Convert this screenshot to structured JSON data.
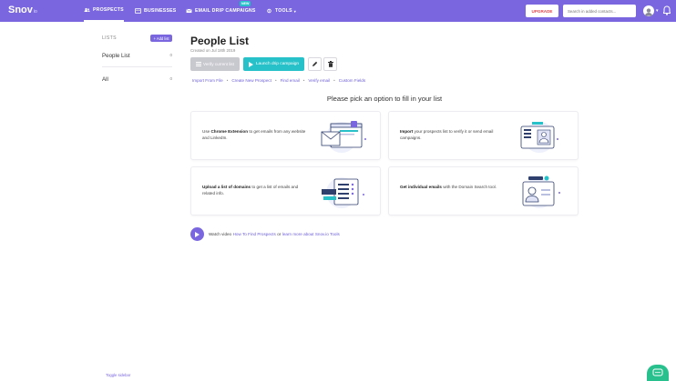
{
  "header": {
    "logo": "Snov",
    "logo_suffix": "io",
    "nav": [
      {
        "label": "PROSPECTS",
        "icon": "people-icon",
        "active": true
      },
      {
        "label": "BUSINESSES",
        "icon": "building-icon",
        "active": false
      },
      {
        "label": "EMAIL DRIP CAMPAIGNS",
        "icon": "mail-icon",
        "active": false,
        "badge": "NEW"
      },
      {
        "label": "TOOLS",
        "icon": "tools-icon",
        "active": false
      }
    ],
    "upgrade_label": "UPGRADE",
    "search_placeholder": "Search in added contacts...",
    "accent": "#7a67e0"
  },
  "sidebar": {
    "title": "LISTS",
    "add_list_label": "+ Add list",
    "items": [
      {
        "label": "People List",
        "count": "0"
      },
      {
        "label": "All",
        "count": "0"
      }
    ],
    "toggle_label": "Toggle sidebar"
  },
  "main": {
    "title": "People List",
    "created": "Created on Jul 18th 2019",
    "verify_label": "Verify current list",
    "launch_label": "Launch drip campaign",
    "links": [
      "Import From File",
      "Create New Prospect",
      "Find email",
      "Verify email",
      "Custom Fields"
    ],
    "pick_title": "Please pick an option to fill in your list",
    "cards": [
      {
        "bold": "Chrome Extension",
        "pre": "Use ",
        "post": " to get emails from any website and LinkedIn.",
        "icon": "browser-mail-illustration"
      },
      {
        "bold": "Import",
        "pre": "",
        "post": " your prospects list to verify it or send email campaigns.",
        "icon": "import-contacts-illustration"
      },
      {
        "bold": "Upload a list of domains",
        "pre": "",
        "post": " to get a list of emails and related info.",
        "icon": "domain-list-illustration"
      },
      {
        "bold": "Get individual emails",
        "pre": "",
        "post": " with the Domain Search tool.",
        "icon": "person-card-illustration"
      }
    ],
    "video": {
      "pre": "Watch video",
      "link1": "How To Find Prospects",
      "mid": "or",
      "link2": "learn more about Snov.io Tools"
    }
  }
}
